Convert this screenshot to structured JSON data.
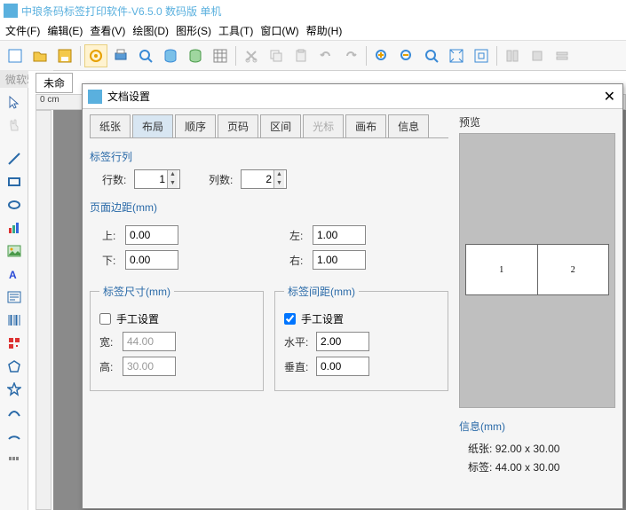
{
  "app": {
    "title": "中琅条码标签打印软件-V6.5.0 数码版 单机"
  },
  "menu": {
    "file": "文件(F)",
    "edit": "编辑(E)",
    "view": "查看(V)",
    "draw": "绘图(D)",
    "shape": "图形(S)",
    "tool": "工具(T)",
    "window": "窗口(W)",
    "help": "帮助(H)"
  },
  "fontbar": "微软雅黑",
  "doctab": "未命",
  "ruler": "0 cm",
  "dialog": {
    "title": "文档设置",
    "tabs": {
      "paper": "纸张",
      "layout": "布局",
      "order": "顺序",
      "page": "页码",
      "range": "区间",
      "cursor": "光标",
      "canvas": "画布",
      "info": "信息"
    },
    "label_rowcol": {
      "title": "标签行列",
      "rows_lbl": "行数:",
      "rows": "1",
      "cols_lbl": "列数:",
      "cols": "2"
    },
    "margins": {
      "title": "页面边距(mm)",
      "top_lbl": "上:",
      "top": "0.00",
      "bottom_lbl": "下:",
      "bottom": "0.00",
      "left_lbl": "左:",
      "left": "1.00",
      "right_lbl": "右:",
      "right": "1.00"
    },
    "label_size": {
      "title": "标签尺寸(mm)",
      "manual": "手工设置",
      "w_lbl": "宽:",
      "w": "44.00",
      "h_lbl": "高:",
      "h": "30.00"
    },
    "label_gap": {
      "title": "标签间距(mm)",
      "manual": "手工设置",
      "hz_lbl": "水平:",
      "hz": "2.00",
      "vt_lbl": "垂直:",
      "vt": "0.00"
    },
    "preview_title": "预览",
    "cells": [
      "1",
      "2"
    ],
    "info": {
      "title": "信息(mm)",
      "paper_lbl": "纸张:",
      "paper": "92.00 x 30.00",
      "label_lbl": "标签:",
      "label": "44.00 x 30.00"
    }
  }
}
